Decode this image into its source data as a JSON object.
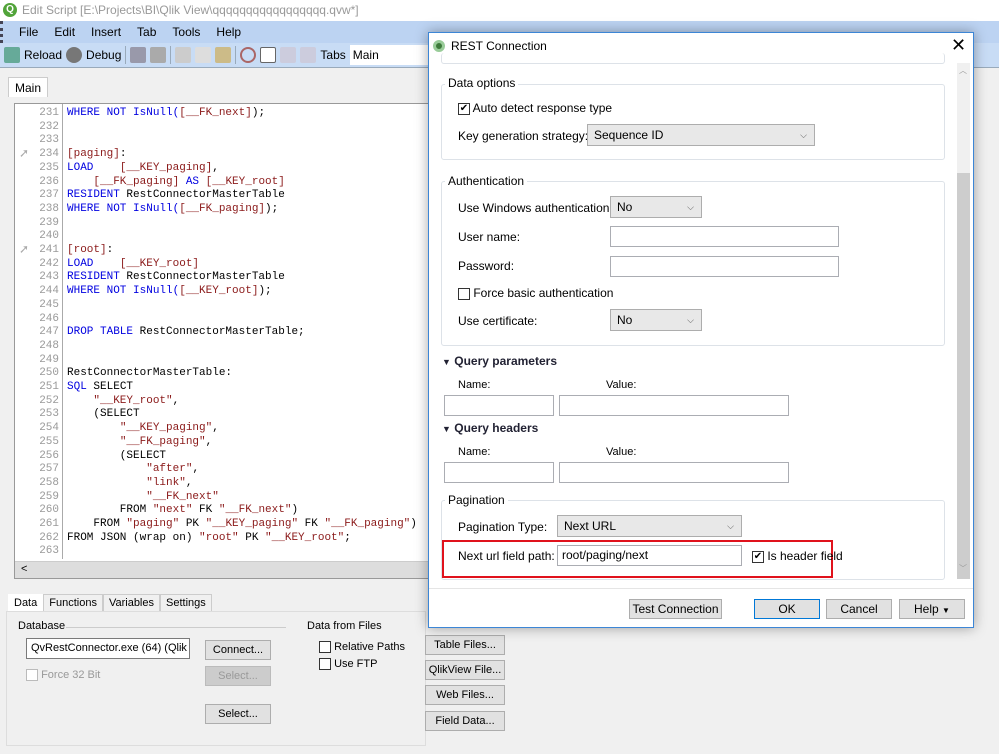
{
  "window": {
    "title": "Edit Script [E:\\Projects\\BI\\Qlik View\\qqqqqqqqqqqqqqqqq.qvw*]",
    "app_icon": "Q"
  },
  "menu": [
    "File",
    "Edit",
    "Insert",
    "Tab",
    "Tools",
    "Help"
  ],
  "toolbar": {
    "reload": "Reload",
    "debug": "Debug",
    "tabs_label": "Tabs",
    "tabs_value": "Main"
  },
  "script_tab": "Main",
  "code": [
    {
      "n": "231",
      "s": [
        [
          "WHERE NOT IsNull(",
          "kw"
        ],
        [
          "[__FK_next]",
          "st"
        ],
        [
          ");",
          "pl"
        ]
      ]
    },
    {
      "n": "232",
      "s": []
    },
    {
      "n": "233",
      "s": []
    },
    {
      "n": "234",
      "bookmark": true,
      "s": [
        [
          "[paging]",
          "st"
        ],
        [
          ":",
          "pl"
        ]
      ]
    },
    {
      "n": "235",
      "s": [
        [
          "LOAD",
          "kw"
        ],
        [
          "    ",
          "pl"
        ],
        [
          "[__KEY_paging]",
          "st"
        ],
        [
          ",",
          "pl"
        ]
      ]
    },
    {
      "n": "236",
      "s": [
        [
          "    ",
          "pl"
        ],
        [
          "[__FK_paging]",
          "st"
        ],
        [
          " AS ",
          "kw"
        ],
        [
          "[__KEY_root]",
          "st"
        ]
      ]
    },
    {
      "n": "237",
      "s": [
        [
          "RESIDENT",
          "kw"
        ],
        [
          " RestConnectorMasterTable",
          "pl"
        ]
      ]
    },
    {
      "n": "238",
      "s": [
        [
          "WHERE NOT IsNull(",
          "kw"
        ],
        [
          "[__FK_paging]",
          "st"
        ],
        [
          ");",
          "pl"
        ]
      ]
    },
    {
      "n": "239",
      "s": []
    },
    {
      "n": "240",
      "s": []
    },
    {
      "n": "241",
      "bookmark": true,
      "s": [
        [
          "[root]",
          "st"
        ],
        [
          ":",
          "pl"
        ]
      ]
    },
    {
      "n": "242",
      "s": [
        [
          "LOAD",
          "kw"
        ],
        [
          "    ",
          "pl"
        ],
        [
          "[__KEY_root]",
          "st"
        ]
      ]
    },
    {
      "n": "243",
      "s": [
        [
          "RESIDENT",
          "kw"
        ],
        [
          " RestConnectorMasterTable",
          "pl"
        ]
      ]
    },
    {
      "n": "244",
      "s": [
        [
          "WHERE NOT IsNull(",
          "kw"
        ],
        [
          "[__KEY_root]",
          "st"
        ],
        [
          ");",
          "pl"
        ]
      ]
    },
    {
      "n": "245",
      "s": []
    },
    {
      "n": "246",
      "s": []
    },
    {
      "n": "247",
      "s": [
        [
          "DROP TABLE",
          "kw"
        ],
        [
          " RestConnectorMasterTable;",
          "pl"
        ]
      ]
    },
    {
      "n": "248",
      "s": []
    },
    {
      "n": "249",
      "s": []
    },
    {
      "n": "250",
      "s": [
        [
          "RestConnectorMasterTable:",
          "pl"
        ]
      ]
    },
    {
      "n": "251",
      "s": [
        [
          "SQL",
          "kw"
        ],
        [
          " SELECT",
          "pl"
        ]
      ]
    },
    {
      "n": "252",
      "s": [
        [
          "    ",
          "pl"
        ],
        [
          "\"__KEY_root\"",
          "st"
        ],
        [
          ",",
          "pl"
        ]
      ]
    },
    {
      "n": "253",
      "s": [
        [
          "    (SELECT",
          "pl"
        ]
      ]
    },
    {
      "n": "254",
      "s": [
        [
          "        ",
          "pl"
        ],
        [
          "\"__KEY_paging\"",
          "st"
        ],
        [
          ",",
          "pl"
        ]
      ]
    },
    {
      "n": "255",
      "s": [
        [
          "        ",
          "pl"
        ],
        [
          "\"__FK_paging\"",
          "st"
        ],
        [
          ",",
          "pl"
        ]
      ]
    },
    {
      "n": "256",
      "s": [
        [
          "        (SELECT",
          "pl"
        ]
      ]
    },
    {
      "n": "257",
      "s": [
        [
          "            ",
          "pl"
        ],
        [
          "\"after\"",
          "st"
        ],
        [
          ",",
          "pl"
        ]
      ]
    },
    {
      "n": "258",
      "s": [
        [
          "            ",
          "pl"
        ],
        [
          "\"link\"",
          "st"
        ],
        [
          ",",
          "pl"
        ]
      ]
    },
    {
      "n": "259",
      "s": [
        [
          "            ",
          "pl"
        ],
        [
          "\"__FK_next\"",
          "st"
        ]
      ]
    },
    {
      "n": "260",
      "s": [
        [
          "        FROM ",
          "pl"
        ],
        [
          "\"next\"",
          "st"
        ],
        [
          " FK ",
          "pl"
        ],
        [
          "\"__FK_next\"",
          "st"
        ],
        [
          ")",
          "pl"
        ]
      ]
    },
    {
      "n": "261",
      "s": [
        [
          "    FROM ",
          "pl"
        ],
        [
          "\"paging\"",
          "st"
        ],
        [
          " PK ",
          "pl"
        ],
        [
          "\"__KEY_paging\"",
          "st"
        ],
        [
          " FK ",
          "pl"
        ],
        [
          "\"__FK_paging\"",
          "st"
        ],
        [
          ")",
          "pl"
        ]
      ]
    },
    {
      "n": "262",
      "s": [
        [
          "FROM JSON (wrap on) ",
          "pl"
        ],
        [
          "\"root\"",
          "st"
        ],
        [
          " PK ",
          "pl"
        ],
        [
          "\"__KEY_root\"",
          "st"
        ],
        [
          ";",
          "pl"
        ]
      ]
    },
    {
      "n": "263",
      "s": []
    }
  ],
  "bottom": {
    "tabs": [
      "Data",
      "Functions",
      "Variables",
      "Settings"
    ],
    "database_label": "Database",
    "database_value": "QvRestConnector.exe  (64) (Qlik",
    "force32": "Force 32 Bit",
    "connect": "Connect...",
    "select_disabled": "Select...",
    "select": "Select...",
    "files_label": "Data from Files",
    "relative_paths": "Relative Paths",
    "use_ftp": "Use FTP",
    "table_files": "Table Files...",
    "qlikview_file": "QlikView File...",
    "web_files": "Web Files...",
    "field_data": "Field Data..."
  },
  "dialog": {
    "title": "REST Connection",
    "data_options": {
      "label": "Data options",
      "auto_detect": "Auto detect response type",
      "auto_detect_checked": true,
      "key_gen_label": "Key generation strategy:",
      "key_gen_value": "Sequence ID"
    },
    "auth": {
      "label": "Authentication",
      "windows_label": "Use Windows authentication:",
      "windows_value": "No",
      "user_label": "User name:",
      "user_value": "",
      "password_label": "Password:",
      "password_value": "",
      "force_basic": "Force basic authentication",
      "force_basic_checked": false,
      "cert_label": "Use certificate:",
      "cert_value": "No"
    },
    "query_params": {
      "label": "Query parameters",
      "name": "Name:",
      "value": "Value:"
    },
    "query_headers": {
      "label": "Query headers",
      "name": "Name:",
      "value": "Value:"
    },
    "pagination": {
      "label": "Pagination",
      "type_label": "Pagination Type:",
      "type_value": "Next URL",
      "next_label": "Next url field path:",
      "next_value": "root/paging/next",
      "is_header": "Is header field",
      "is_header_checked": true
    },
    "buttons": {
      "test": "Test Connection",
      "ok": "OK",
      "cancel": "Cancel",
      "help": "Help"
    },
    "highlight_color": "#e0121c"
  }
}
